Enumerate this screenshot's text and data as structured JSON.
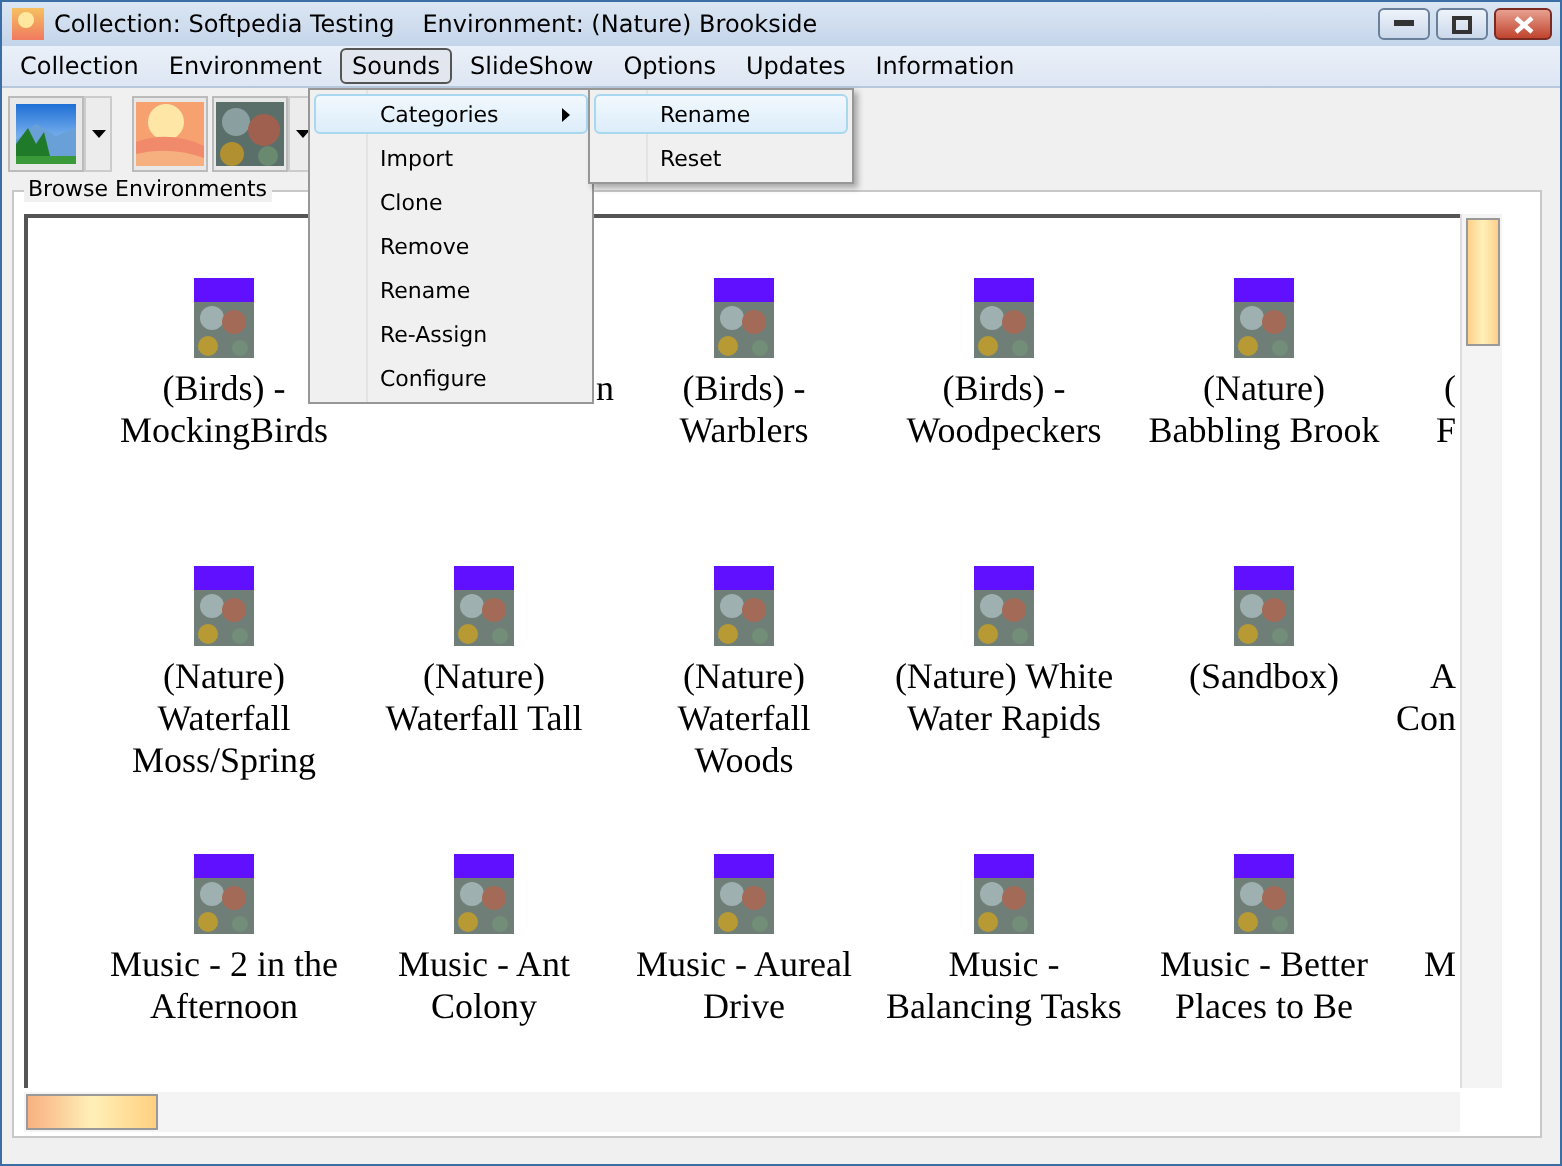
{
  "window": {
    "title": "Collection: Softpedia Testing",
    "environment": "Environment: (Nature) Brookside"
  },
  "menu": [
    {
      "label": "Collection",
      "selected": false
    },
    {
      "label": "Environment",
      "selected": false
    },
    {
      "label": "Sounds",
      "selected": true
    },
    {
      "label": "SlideShow",
      "selected": false
    },
    {
      "label": "Options",
      "selected": false
    },
    {
      "label": "Updates",
      "selected": false
    },
    {
      "label": "Information",
      "selected": false
    }
  ],
  "sounds_menu": [
    {
      "label": "Categories",
      "submenu": true,
      "highlighted": true
    },
    {
      "label": "Import",
      "submenu": false,
      "highlighted": false
    },
    {
      "label": "Clone",
      "submenu": false,
      "highlighted": false
    },
    {
      "label": "Remove",
      "submenu": false,
      "highlighted": false
    },
    {
      "label": "Rename",
      "submenu": false,
      "highlighted": false
    },
    {
      "label": "Re-Assign",
      "submenu": false,
      "highlighted": false
    },
    {
      "label": "Configure",
      "submenu": false,
      "highlighted": false
    }
  ],
  "categories_submenu": [
    {
      "label": "Rename",
      "highlighted": true
    },
    {
      "label": "Reset",
      "highlighted": false
    }
  ],
  "group_title": "Browse Environments",
  "environments": [
    {
      "kind": "full",
      "lines": [
        "(Birds) -",
        "MockingBirds"
      ]
    },
    {
      "kind": "covered",
      "lines": [
        "n"
      ]
    },
    {
      "kind": "full",
      "lines": [
        "(Birds) -",
        "Warblers"
      ]
    },
    {
      "kind": "full",
      "lines": [
        "(Birds) -",
        "Woodpeckers"
      ]
    },
    {
      "kind": "full",
      "lines": [
        "(Nature)",
        "Babbling Brook"
      ]
    },
    {
      "kind": "cut",
      "lines": [
        "(",
        "F"
      ]
    },
    {
      "kind": "full",
      "lines": [
        "(Nature)",
        "Waterfall",
        "Moss/Spring"
      ]
    },
    {
      "kind": "full",
      "lines": [
        "(Nature)",
        "Waterfall Tall"
      ]
    },
    {
      "kind": "full",
      "lines": [
        "(Nature)",
        "Waterfall",
        "Woods"
      ]
    },
    {
      "kind": "full",
      "lines": [
        "(Nature) White",
        "Water Rapids"
      ]
    },
    {
      "kind": "full",
      "lines": [
        "(Sandbox)"
      ]
    },
    {
      "kind": "cut",
      "lines": [
        "A",
        "Con"
      ]
    },
    {
      "kind": "full",
      "lines": [
        "Music - 2 in the",
        "Afternoon"
      ]
    },
    {
      "kind": "full",
      "lines": [
        "Music - Ant",
        "Colony"
      ]
    },
    {
      "kind": "full",
      "lines": [
        "Music - Aureal",
        "Drive"
      ]
    },
    {
      "kind": "full",
      "lines": [
        "Music -",
        "Balancing Tasks"
      ]
    },
    {
      "kind": "full",
      "lines": [
        "Music - Better",
        "Places to Be"
      ]
    },
    {
      "kind": "cut",
      "lines": [
        "M"
      ]
    }
  ]
}
